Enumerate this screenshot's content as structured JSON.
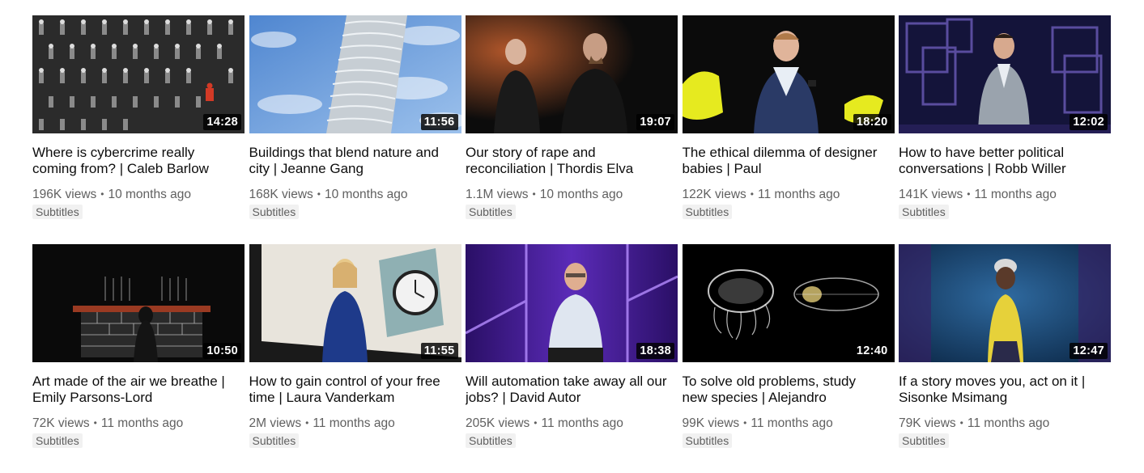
{
  "videos": [
    {
      "title": "Where is cybercrime really coming from? | Caleb Barlow",
      "views": "196K views",
      "age": "10 months ago",
      "duration": "14:28",
      "badge": "Subtitles"
    },
    {
      "title": "Buildings that blend nature and city | Jeanne Gang",
      "views": "168K views",
      "age": "10 months ago",
      "duration": "11:56",
      "badge": "Subtitles"
    },
    {
      "title": "Our story of rape and reconciliation | Thordis Elva",
      "views": "1.1M views",
      "age": "10 months ago",
      "duration": "19:07",
      "badge": "Subtitles"
    },
    {
      "title": "The ethical dilemma of designer babies | Paul",
      "views": "122K views",
      "age": "11 months ago",
      "duration": "18:20",
      "badge": "Subtitles"
    },
    {
      "title": "How to have better political conversations | Robb Willer",
      "views": "141K views",
      "age": "11 months ago",
      "duration": "12:02",
      "badge": "Subtitles"
    },
    {
      "title": "Art made of the air we breathe | Emily Parsons-Lord",
      "views": "72K views",
      "age": "11 months ago",
      "duration": "10:50",
      "badge": "Subtitles"
    },
    {
      "title": "How to gain control of your free time | Laura Vanderkam",
      "views": "2M views",
      "age": "11 months ago",
      "duration": "11:55",
      "badge": "Subtitles"
    },
    {
      "title": "Will automation take away all our jobs? | David Autor",
      "views": "205K views",
      "age": "11 months ago",
      "duration": "18:38",
      "badge": "Subtitles"
    },
    {
      "title": "To solve old problems, study new species | Alejandro",
      "views": "99K views",
      "age": "11 months ago",
      "duration": "12:40",
      "badge": "Subtitles"
    },
    {
      "title": "If a story moves you, act on it | Sisonke Msimang",
      "views": "79K views",
      "age": "11 months ago",
      "duration": "12:47",
      "badge": "Subtitles"
    }
  ],
  "meta_separator": "•",
  "thumbnails": [
    {
      "subject": "cybercrime-figures-pattern",
      "colors": [
        "#2b2b2b",
        "#8a8a8a",
        "#d23a26"
      ]
    },
    {
      "subject": "wavy-skyscraper",
      "colors": [
        "#6d9fdc",
        "#dfe6ec",
        "#aab3bb"
      ]
    },
    {
      "subject": "two-speakers-stage",
      "colors": [
        "#0c0c0c",
        "#b0562a",
        "#d9b39c"
      ]
    },
    {
      "subject": "speaker-yellow-props",
      "colors": [
        "#0b0b0b",
        "#e6ea1f",
        "#3a4a7a"
      ]
    },
    {
      "subject": "speaker-purple-stage",
      "colors": [
        "#14143a",
        "#6b5bb8",
        "#9aa3ad"
      ]
    },
    {
      "subject": "brick-counter-installation",
      "colors": [
        "#0a0a0a",
        "#9a3a22",
        "#c8c8c8"
      ]
    },
    {
      "subject": "speaker-clock-screen",
      "colors": [
        "#e8e4dc",
        "#1e3a8a",
        "#e8c98a"
      ]
    },
    {
      "subject": "speaker-purple-lights",
      "colors": [
        "#3a1a7a",
        "#9b5cff",
        "#dfe6f0"
      ]
    },
    {
      "subject": "jellyfish-specimens",
      "colors": [
        "#000000",
        "#e8e8e8",
        "#c9b56a"
      ]
    },
    {
      "subject": "speaker-blue-stage",
      "colors": [
        "#0d2a4a",
        "#e6d13a",
        "#5a3a2a"
      ]
    }
  ]
}
